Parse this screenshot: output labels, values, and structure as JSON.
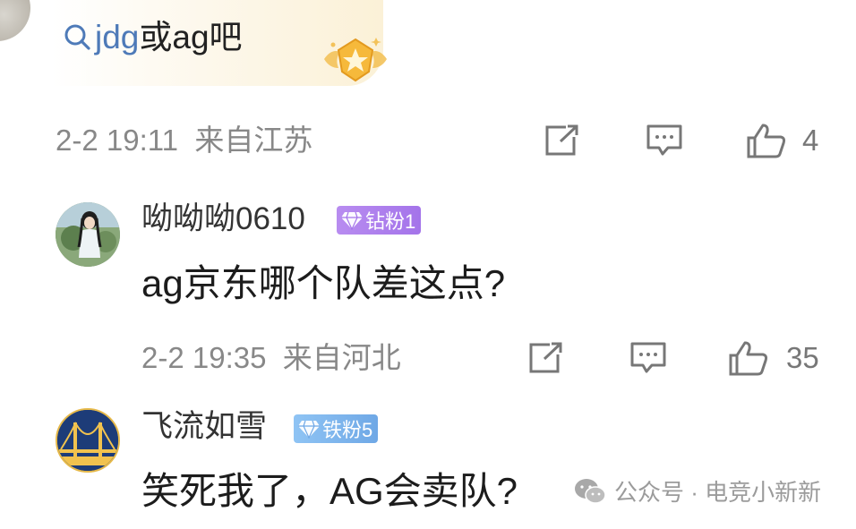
{
  "top_comment": {
    "search_link": {
      "query": "jdg",
      "rest": " 或ag吧"
    },
    "meta": {
      "time": "2-2 19:11",
      "location": "来自江苏",
      "likes": "4"
    }
  },
  "replies": [
    {
      "username": "呦呦呦0610",
      "badge": "钻粉1",
      "content": "ag京东哪个队差这点?",
      "meta": {
        "time": "2-2 19:35",
        "location": "来自河北",
        "likes": "35"
      }
    },
    {
      "username": "飞流如雪",
      "badge": "铁粉5",
      "content": "笑死我了，AG会卖队?"
    }
  ],
  "watermark": {
    "text": "公众号 · 电竞小新新"
  },
  "colors": {
    "link_blue": "#4e7ab8",
    "meta_gray": "#888888",
    "diamond_badge": "#a474ea",
    "iron_badge": "#6fa8e6"
  },
  "icons": {
    "share": "share-icon",
    "reply": "comment-icon",
    "like": "thumbs-up-icon",
    "search": "search-icon"
  }
}
